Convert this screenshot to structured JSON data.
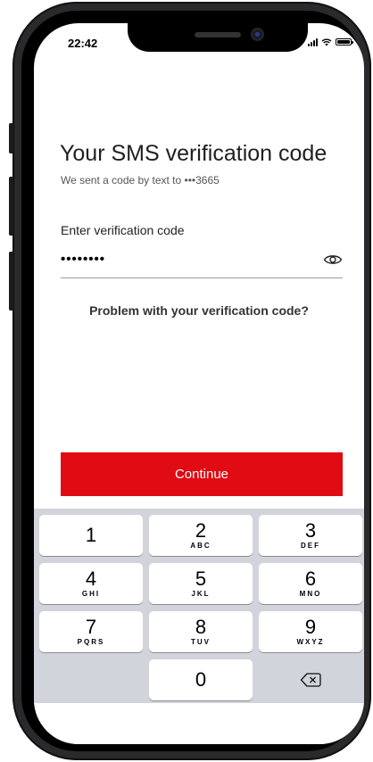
{
  "status_bar": {
    "time": "22:42"
  },
  "header": {
    "title": "Your SMS verification code",
    "subtitle": "We sent a code by text to •••3665"
  },
  "form": {
    "label": "Enter verification code",
    "masked_value": "••••••••",
    "toggle_icon": "eye-icon"
  },
  "problem_link": "Problem with your verification code?",
  "continue_label": "Continue",
  "colors": {
    "accent": "#e00b13",
    "keypad_bg": "#d1d4da"
  },
  "keypad": {
    "keys": [
      {
        "num": "1",
        "letters": ""
      },
      {
        "num": "2",
        "letters": "ABC"
      },
      {
        "num": "3",
        "letters": "DEF"
      },
      {
        "num": "4",
        "letters": "GHI"
      },
      {
        "num": "5",
        "letters": "JKL"
      },
      {
        "num": "6",
        "letters": "MNO"
      },
      {
        "num": "7",
        "letters": "PQRS"
      },
      {
        "num": "8",
        "letters": "TUV"
      },
      {
        "num": "9",
        "letters": "WXYZ"
      },
      {
        "num": "0",
        "letters": ""
      }
    ],
    "delete_icon": "backspace-icon"
  }
}
